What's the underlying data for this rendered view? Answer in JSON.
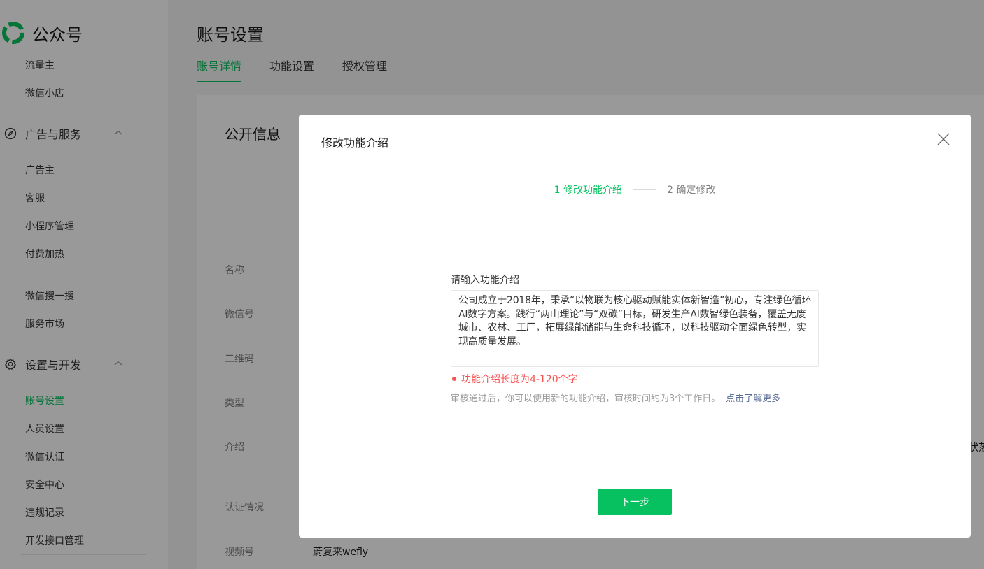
{
  "sidebar": {
    "brand": "公众号",
    "items_top": [
      "流量主",
      "微信小店"
    ],
    "group_ads": {
      "label": "广告与服务",
      "items": [
        "广告主",
        "客服",
        "小程序管理",
        "付费加热"
      ]
    },
    "items_mid": [
      "微信搜一搜",
      "服务市场"
    ],
    "group_dev": {
      "label": "设置与开发",
      "items": [
        "账号设置",
        "人员设置",
        "微信认证",
        "安全中心",
        "违规记录",
        "开发接口管理"
      ]
    }
  },
  "main": {
    "title": "账号设置",
    "tabs": [
      "账号详情",
      "功能设置",
      "授权管理"
    ],
    "card": {
      "title": "公开信息",
      "rows": [
        "名称",
        "微信号",
        "二维码",
        "类型",
        "介绍",
        "认证情况",
        "视频号"
      ],
      "video_value": "蔚复来wefly",
      "edge_text": "状落"
    }
  },
  "dialog": {
    "title": "修改功能介绍",
    "step1": "1 修改功能介绍",
    "step2": "2 确定修改",
    "field_label": "请输入功能介绍",
    "field_value": "公司成立于2018年，秉承“以物联为核心驱动赋能实体新智造”初心，专注绿色循环AI数字方案。践行“两山理论”与“双碳”目标，研发生产AI数智绿色装备，覆盖无废城市、农林、工厂，拓展绿能储能与生命科技循环，以科技驱动全面绿色转型，实现高质量发展。",
    "error": "功能介绍长度为4-120个字",
    "tip": "审核通过后，你可以使用新的功能介绍，审核时间约为3个工作日。",
    "tip_link": "点击了解更多",
    "next": "下一步"
  },
  "colors": {
    "accent": "#07c160",
    "error": "#fa5151",
    "link": "#576b95"
  },
  "icons": [
    "wechat-mp-logo-icon",
    "compass-icon",
    "gear-icon",
    "chevron-up-icon",
    "close-icon"
  ]
}
